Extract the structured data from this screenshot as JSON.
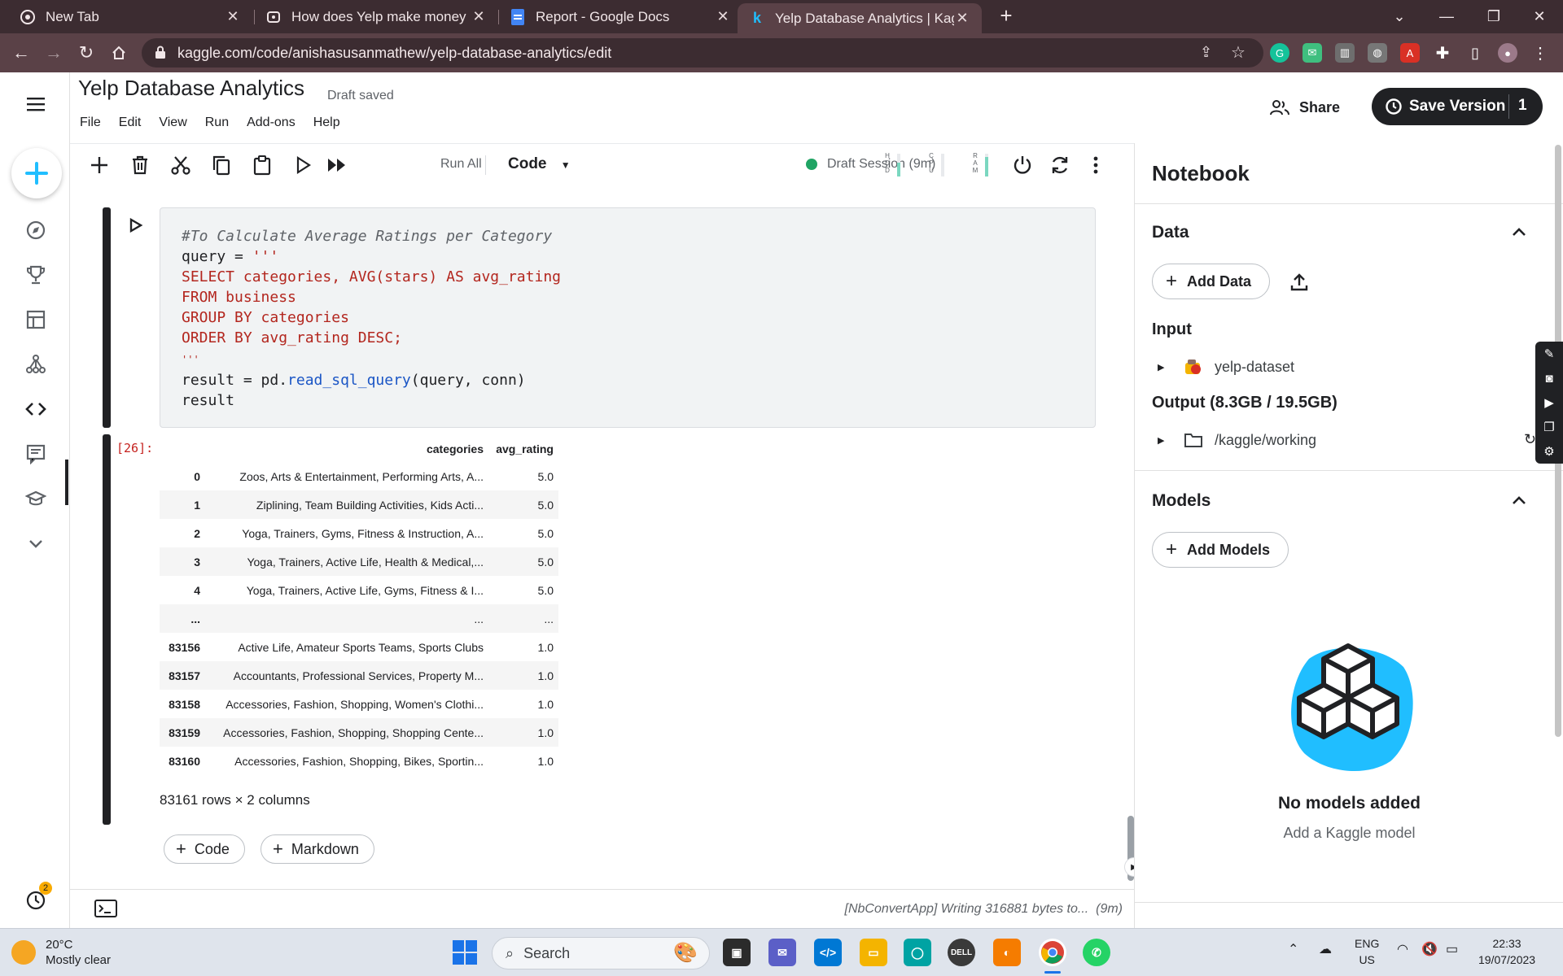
{
  "browser": {
    "tabs": [
      {
        "title": "New Tab",
        "favicon": "chrome-icon"
      },
      {
        "title": "How does Yelp make money | Bu",
        "favicon": "page-icon"
      },
      {
        "title": "Report - Google Docs",
        "favicon": "docs-icon"
      },
      {
        "title": "Yelp Database Analytics | Kaggle",
        "favicon": "kaggle-icon"
      }
    ],
    "url": "kaggle.com/code/anishasusanmathew/yelp-database-analytics/edit"
  },
  "notebook": {
    "title": "Yelp Database Analytics",
    "save_status": "Draft saved",
    "menu": [
      "File",
      "Edit",
      "View",
      "Run",
      "Add-ons",
      "Help"
    ],
    "share_label": "Share",
    "save_version_label": "Save Version",
    "save_version_count": "1",
    "toolbar": {
      "run_all_label": "Run All",
      "cell_type": "Code",
      "session_label": "Draft Session (9m)",
      "meters": [
        {
          "letters": "HDD",
          "level": 0.6
        },
        {
          "letters": "CPU",
          "level": 0.0
        },
        {
          "letters": "RAM",
          "level": 0.85
        }
      ]
    }
  },
  "cell": {
    "code_lines": {
      "l1": "#To Calculate Average Ratings per Category",
      "l2a": "query = ",
      "l2b": "'''",
      "l3": "SELECT categories, AVG(stars) AS avg_rating",
      "l4": "FROM business",
      "l5": "GROUP BY categories",
      "l6": "ORDER BY avg_rating DESC;",
      "l7": "'''",
      "l8a": "result = pd.",
      "l8b": "read_sql_query",
      "l8c": "(query, conn)",
      "l9": "result"
    },
    "output_prompt": "[26]:",
    "table": {
      "columns": [
        "",
        "categories",
        "avg_rating"
      ],
      "rows": [
        [
          "0",
          "Zoos, Arts & Entertainment, Performing Arts, A...",
          "5.0"
        ],
        [
          "1",
          "Ziplining, Team Building Activities, Kids Acti...",
          "5.0"
        ],
        [
          "2",
          "Yoga, Trainers, Gyms, Fitness & Instruction, A...",
          "5.0"
        ],
        [
          "3",
          "Yoga, Trainers, Active Life, Health & Medical,...",
          "5.0"
        ],
        [
          "4",
          "Yoga, Trainers, Active Life, Gyms, Fitness & I...",
          "5.0"
        ],
        [
          "...",
          "...",
          "..."
        ],
        [
          "83156",
          "Active Life, Amateur Sports Teams, Sports Clubs",
          "1.0"
        ],
        [
          "83157",
          "Accountants, Professional Services, Property M...",
          "1.0"
        ],
        [
          "83158",
          "Accessories, Fashion, Shopping, Women's Clothi...",
          "1.0"
        ],
        [
          "83159",
          "Accessories, Fashion, Shopping, Shopping Cente...",
          "1.0"
        ],
        [
          "83160",
          "Accessories, Fashion, Shopping, Bikes, Sportin...",
          "1.0"
        ]
      ],
      "shape": "83161 rows × 2 columns"
    },
    "add_code_label": "Code",
    "add_markdown_label": "Markdown"
  },
  "status_bar": {
    "message": "[NbConvertApp] Writing 316881 bytes to...",
    "elapsed": "(9m)"
  },
  "panel": {
    "title": "Notebook",
    "data_heading": "Data",
    "add_data_label": "Add Data",
    "input_heading": "Input",
    "input_item": "yelp-dataset",
    "output_heading": "Output (8.3GB / 19.5GB)",
    "output_item": "/kaggle/working",
    "models_heading": "Models",
    "add_models_label": "Add Models",
    "empty_title": "No models added",
    "empty_sub": "Add a Kaggle model"
  },
  "taskbar": {
    "temperature": "20°C",
    "weather": "Mostly clear",
    "search_label": "Search",
    "lang_top": "ENG",
    "lang_bottom": "US",
    "time": "22:33",
    "date": "19/07/2023",
    "history_badge": "2"
  },
  "colors": {
    "browser_frame": "#3c2c31",
    "browser_toolbar": "#5a4147",
    "kaggle_blue": "#20beff",
    "session_green": "#20a464",
    "prompt_red": "#c5221f"
  }
}
